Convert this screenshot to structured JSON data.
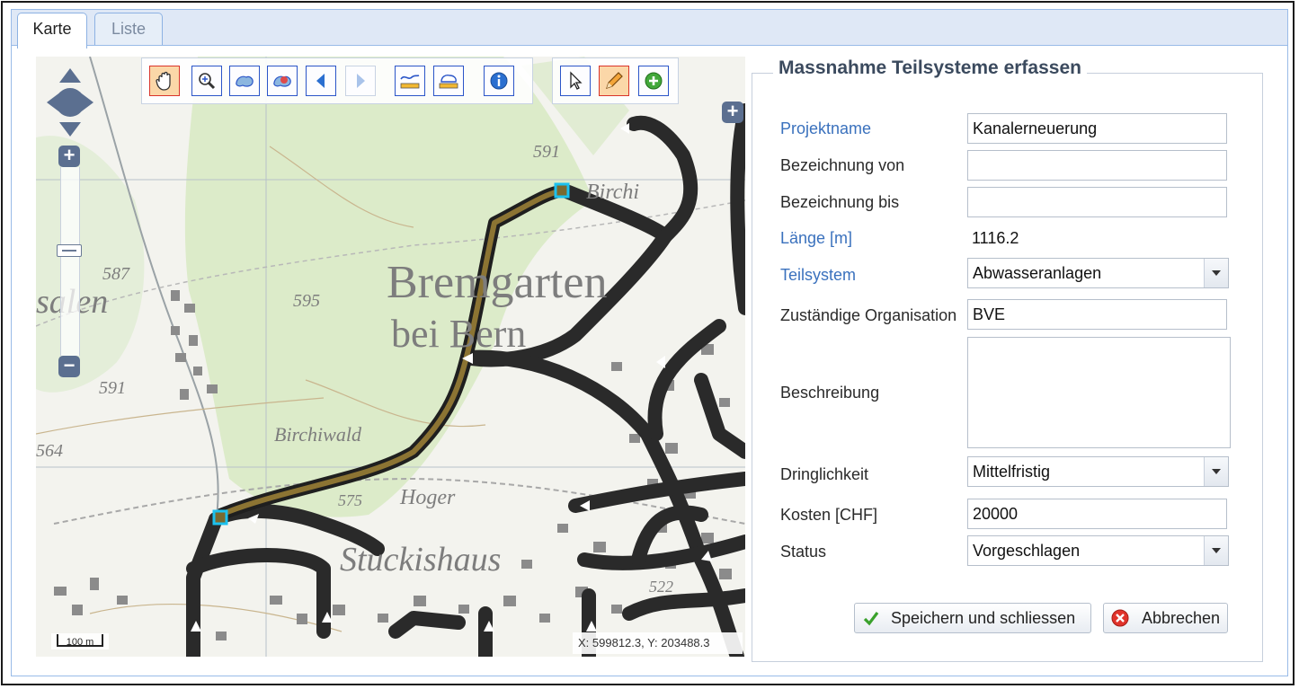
{
  "tabs": [
    {
      "label": "Karte",
      "active": true
    },
    {
      "label": "Liste",
      "active": false
    }
  ],
  "map": {
    "labels": {
      "town": "Bremgarten",
      "town2": "bei Bern",
      "forest": "Birchiwald",
      "place1": "Hoger",
      "place2": "Stuckishaus",
      "place3": "Birchi",
      "left1": "salen",
      "e591a": "591",
      "e587": "587",
      "e595": "595",
      "e591b": "591",
      "e575": "575",
      "e564": "564",
      "e522": "522"
    },
    "scale_label": "100 m",
    "coordinates": "X: 599812.3, Y: 203488.3",
    "toolbar": [
      "pan-icon",
      "zoom-in-box-icon",
      "zoom-extent-icon",
      "zoom-layer-icon",
      "back-icon",
      "forward-icon",
      "measure-line-icon",
      "measure-area-icon",
      "info-icon"
    ],
    "edit_toolbar": [
      "select-icon",
      "pencil-icon",
      "add-icon"
    ]
  },
  "form": {
    "title": "Massnahme Teilsysteme erfassen",
    "fields": {
      "projektname_label": "Projektname",
      "projektname_value": "Kanalerneuerung",
      "bez_von_label": "Bezeichnung von",
      "bez_von_value": "",
      "bez_bis_label": "Bezeichnung bis",
      "bez_bis_value": "",
      "laenge_label": "Länge [m]",
      "laenge_value": "1116.2",
      "teilsystem_label": "Teilsystem",
      "teilsystem_value": "Abwasseranlagen",
      "org_label": "Zuständige Organisation",
      "org_value": "BVE",
      "beschreibung_label": "Beschreibung",
      "beschreibung_value": "",
      "dringlichkeit_label": "Dringlichkeit",
      "dringlichkeit_value": "Mittelfristig",
      "kosten_label": "Kosten [CHF]",
      "kosten_value": "20000",
      "status_label": "Status",
      "status_value": "Vorgeschlagen"
    },
    "buttons": {
      "save": "Speichern und schliessen",
      "cancel": "Abbrechen"
    }
  },
  "colors": {
    "accent_blue": "#3a71bd",
    "pipe": "#2a2a2a",
    "selected_pipe": "#8c7433"
  }
}
